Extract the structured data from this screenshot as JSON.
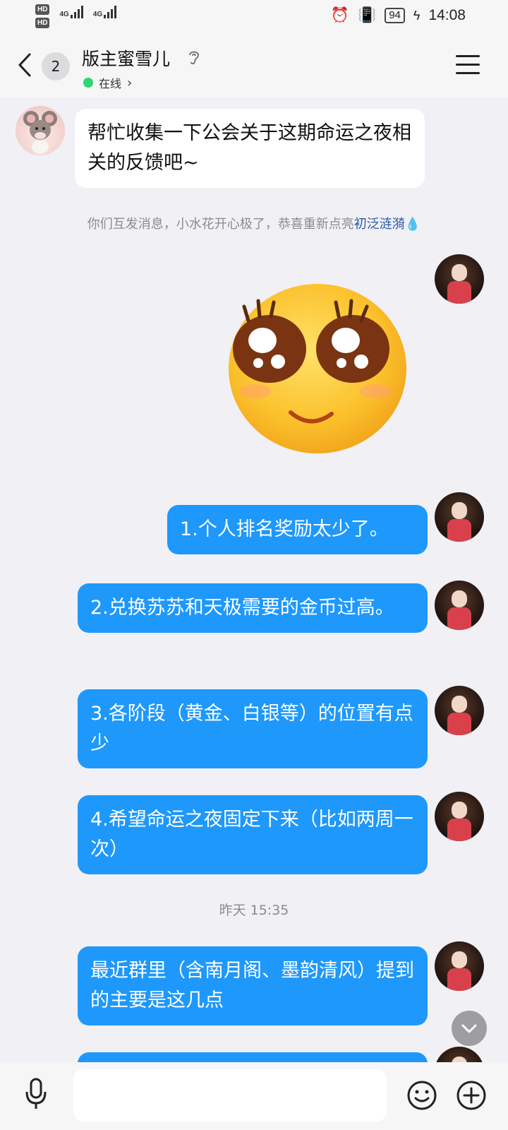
{
  "status_bar": {
    "hd1": "HD",
    "hd2": "HD",
    "net1": "4G",
    "net2": "4G",
    "battery": "94",
    "time": "14:08"
  },
  "header": {
    "unread_count": "2",
    "title": "版主蜜雪儿",
    "presence": "在线",
    "presence_color": "#2ed573"
  },
  "messages": {
    "incoming": "帮忙收集一下公会关于这期命运之夜相关的反馈吧~",
    "notice_text": "你们互发消息，小水花开心极了，恭喜重新点亮",
    "notice_link": "初泛涟漪",
    "outgoing": [
      "1.个人排名奖励太少了。",
      "2.兑换苏苏和天极需要的金币过高。",
      "3.各阶段（黄金、白银等）的位置有点少",
      "4.希望命运之夜固定下来（比如两周一次）",
      "最近群里（含南月阁、墨韵清风）提到的主要是这几点"
    ],
    "timestamp": "昨天 15:35"
  },
  "colors": {
    "accent_bubble": "#1e98fb",
    "background": "#f0f0f5"
  },
  "icons": {
    "back": "chevron-left-icon",
    "hint": "ear-icon",
    "menu": "hamburger-menu-icon",
    "mic": "microphone-icon",
    "emoji": "smiley-icon",
    "add": "plus-circle-icon",
    "scroll": "chevron-down-icon"
  }
}
